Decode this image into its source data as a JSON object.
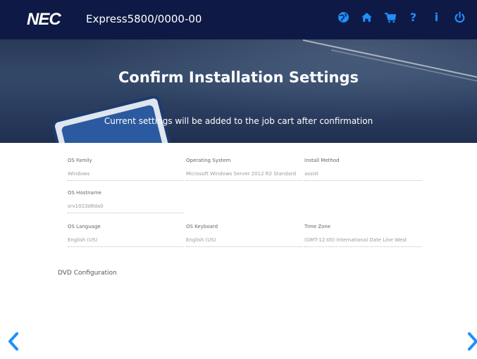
{
  "header": {
    "logo": "NEC",
    "model": "Express5800/0000-00",
    "icons": [
      "globe-icon",
      "home-icon",
      "cart-icon",
      "help-icon",
      "info-icon",
      "power-icon"
    ],
    "accent_color": "#1e90ff",
    "bar_color": "#0e1a45"
  },
  "banner": {
    "title": "Confirm Installation Settings",
    "subtitle": "Current settings will be added to the job cart after confirmation"
  },
  "fields": {
    "os_family": {
      "label": "OS Family",
      "value": "Windows"
    },
    "operating_system": {
      "label": "Operating System",
      "value": "Microsoft Windows Server 2012 R2 Standard"
    },
    "install_method": {
      "label": "Install Method",
      "value": "assist"
    },
    "os_hostname": {
      "label": "OS Hostname",
      "value": "srv1023d8da0"
    },
    "os_language": {
      "label": "OS Language",
      "value": "English (US)"
    },
    "os_keyboard": {
      "label": "OS Keyboard",
      "value": "English (US)"
    },
    "time_zone": {
      "label": "Time Zone",
      "value": "(GMT-12:00) International Date Line West"
    }
  },
  "sections": {
    "dvd_configuration": "DVD Configuration"
  },
  "navigation": {
    "prev_icon": "chevron-left-icon",
    "next_icon": "chevron-right-icon"
  }
}
